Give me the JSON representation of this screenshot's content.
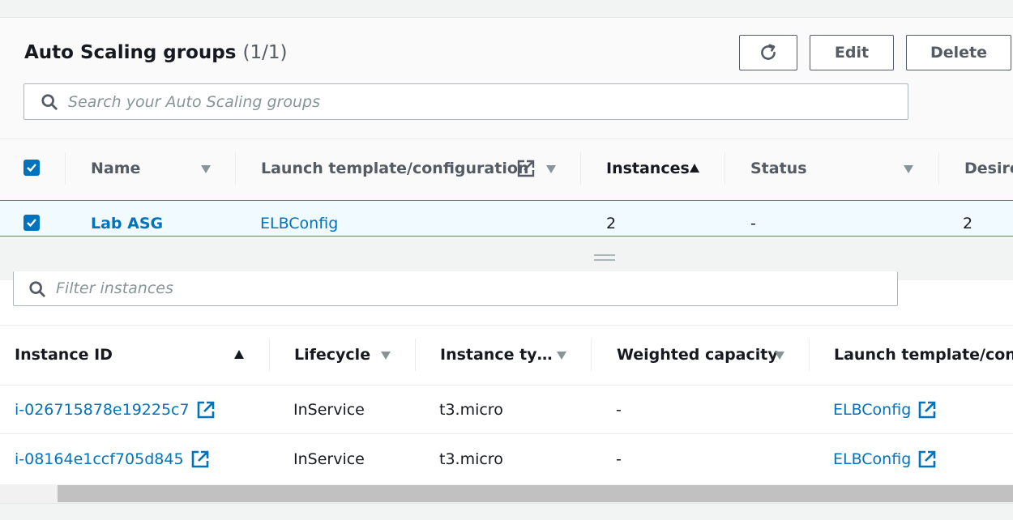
{
  "asg_panel": {
    "title": "Auto Scaling groups",
    "count": "(1/1)",
    "refresh_icon": "refresh-icon",
    "edit_label": "Edit",
    "delete_label": "Delete",
    "search_placeholder": "Search your Auto Scaling groups",
    "columns": [
      "Name",
      "Launch template/configuration",
      "Instances",
      "Status",
      "Desire"
    ],
    "row": {
      "selected": true,
      "name": "Lab ASG",
      "launch_config": "ELBConfig",
      "instances": "2",
      "status": "-",
      "desired": "2"
    }
  },
  "instances_panel": {
    "filter_placeholder": "Filter instances",
    "columns": [
      "Instance ID",
      "Lifecycle",
      "Instance ty…",
      "Weighted capacity",
      "Launch template/confi"
    ],
    "rows": [
      {
        "instance_id": "i-026715878e19225c7",
        "lifecycle": "InService",
        "instance_type": "t3.micro",
        "weighted_capacity": "-",
        "launch_template": "ELBConfig"
      },
      {
        "instance_id": "i-08164e1ccf705d845",
        "lifecycle": "InService",
        "instance_type": "t3.micro",
        "weighted_capacity": "-",
        "launch_template": "ELBConfig"
      }
    ]
  },
  "colors": {
    "link": "#0073bb",
    "selected_row_bg": "#f1faff",
    "selected_row_border": "#00a1c9",
    "checkbox": "#0073bb"
  }
}
